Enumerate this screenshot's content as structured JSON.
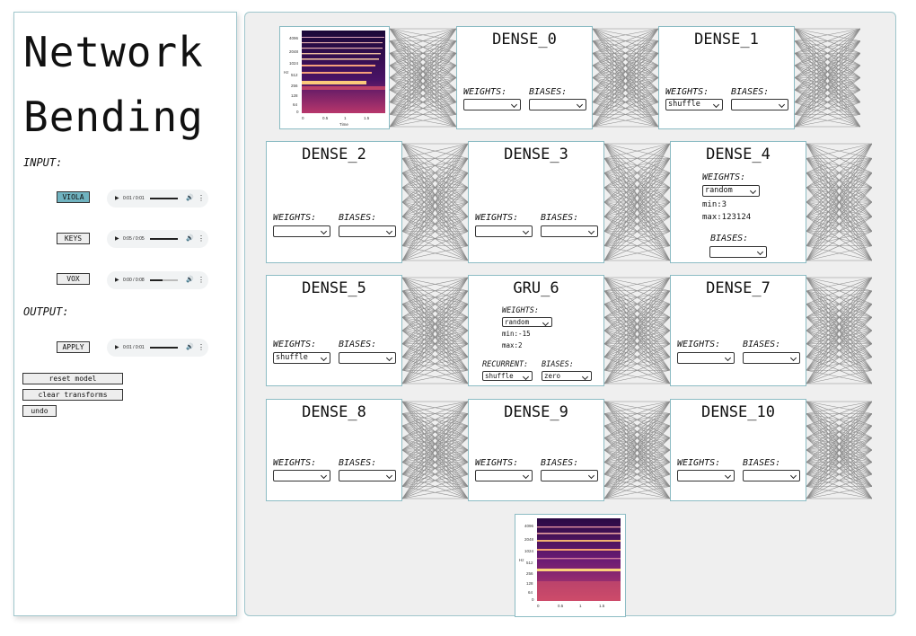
{
  "app": {
    "title": "Network Bending"
  },
  "input": {
    "heading": "INPUT:",
    "items": [
      {
        "label": "VIOLA",
        "time": "0:01 / 0:01",
        "active": true
      },
      {
        "label": "KEYS",
        "time": "0:05 / 0:05",
        "active": false
      },
      {
        "label": "VOX",
        "time": "0:00 / 0:08",
        "active": false
      }
    ]
  },
  "output": {
    "heading": "OUTPUT:",
    "apply_label": "APPLY",
    "time": "0:01 / 0:01"
  },
  "controls": {
    "reset": "reset model",
    "clear": "clear transforms",
    "undo": "undo"
  },
  "player_icons": {
    "play": "▶",
    "volume": "🔊",
    "more": "⋮"
  },
  "spectrogram": {
    "yticks": [
      "4096",
      "2048",
      "1024",
      "512",
      "256",
      "128",
      "64",
      "0"
    ],
    "xticks": [
      "0",
      "0.5",
      "1",
      "1.5"
    ],
    "xlabel": "Time",
    "ylabel": "Hz"
  },
  "layers": [
    {
      "name": "DENSE_0",
      "weights": "",
      "biases": ""
    },
    {
      "name": "DENSE_1",
      "weights": "shuffle",
      "biases": ""
    },
    {
      "name": "DENSE_2",
      "weights": "",
      "biases": ""
    },
    {
      "name": "DENSE_3",
      "weights": "",
      "biases": ""
    },
    {
      "name": "DENSE_4",
      "weights": "random",
      "weights_min": "min:3",
      "weights_max": "max:123124",
      "biases": ""
    },
    {
      "name": "DENSE_5",
      "weights": "shuffle",
      "biases": ""
    },
    {
      "name": "GRU_6",
      "weights": "random",
      "weights_min": "min:-15",
      "weights_max": "max:2",
      "recurrent": "shuffle",
      "biases": "zero"
    },
    {
      "name": "DENSE_7",
      "weights": "",
      "biases": ""
    },
    {
      "name": "DENSE_8",
      "weights": "",
      "biases": ""
    },
    {
      "name": "DENSE_9",
      "weights": "",
      "biases": ""
    },
    {
      "name": "DENSE_10",
      "weights": "",
      "biases": ""
    }
  ],
  "labels": {
    "weights": "WEIGHTS:",
    "biases": "BIASES:",
    "recurrent": "RECURRENT:"
  }
}
